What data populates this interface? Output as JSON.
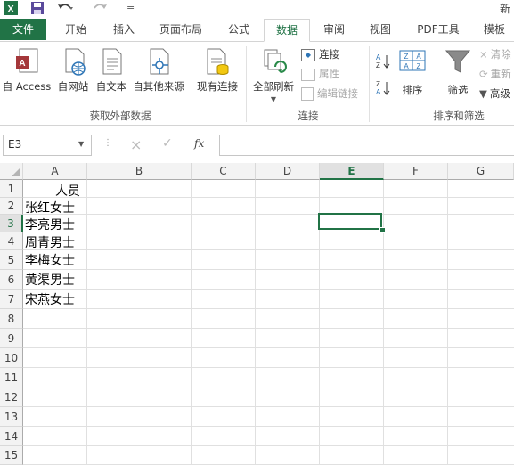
{
  "title_bar": {
    "app_icon": "excel-logo-icon",
    "title_partial": "新",
    "qat": [
      "save-icon",
      "undo-icon",
      "redo-icon",
      "customize-qat-icon"
    ]
  },
  "tabs": [
    {
      "label": "文件"
    },
    {
      "label": "开始"
    },
    {
      "label": "插入"
    },
    {
      "label": "页面布局"
    },
    {
      "label": "公式"
    },
    {
      "label": "数据"
    },
    {
      "label": "审阅"
    },
    {
      "label": "视图"
    },
    {
      "label": "PDF工具"
    },
    {
      "label": "模板"
    }
  ],
  "active_tab": "数据",
  "ribbon": {
    "group_external": {
      "label": "获取外部数据",
      "buttons": [
        {
          "label": "自 Access",
          "icon": "access-db-icon"
        },
        {
          "label": "自网站",
          "icon": "web-page-icon"
        },
        {
          "label": "自文本",
          "icon": "text-file-icon"
        },
        {
          "label": "自其他来源",
          "icon": "other-sources-icon"
        },
        {
          "label": "现有连接",
          "icon": "existing-connections-icon"
        }
      ]
    },
    "group_connections": {
      "label": "连接",
      "refresh_all": "全部刷新",
      "connections": "连接",
      "properties": "属性",
      "edit_links": "编辑链接"
    },
    "group_sort_filter": {
      "label": "排序和筛选",
      "sort": "排序",
      "filter": "筛选",
      "clear": "清除",
      "reapply": "重新",
      "advanced": "高级"
    }
  },
  "formula_bar": {
    "name_box": "E3",
    "cancel_icon": "×",
    "enter_icon": "✓",
    "fx_label": "fx",
    "formula": ""
  },
  "columns": [
    "A",
    "B",
    "C",
    "D",
    "E",
    "F",
    "G"
  ],
  "selected_column": "E",
  "rows": [
    "1",
    "2",
    "3",
    "4",
    "5",
    "6",
    "7",
    "8",
    "9",
    "10",
    "11",
    "12",
    "13",
    "14",
    "15"
  ],
  "selected_row": "3",
  "cells": {
    "A1": "人员",
    "A2": "张红女士",
    "A3": "李亮男士",
    "A4": "周青男士",
    "A5": "李梅女士",
    "A6": "黄渠男士",
    "A7": "宋燕女士"
  },
  "colors": {
    "accent": "#217346",
    "header_bg": "#f3f3f3",
    "grid": "#e0e0e0"
  }
}
